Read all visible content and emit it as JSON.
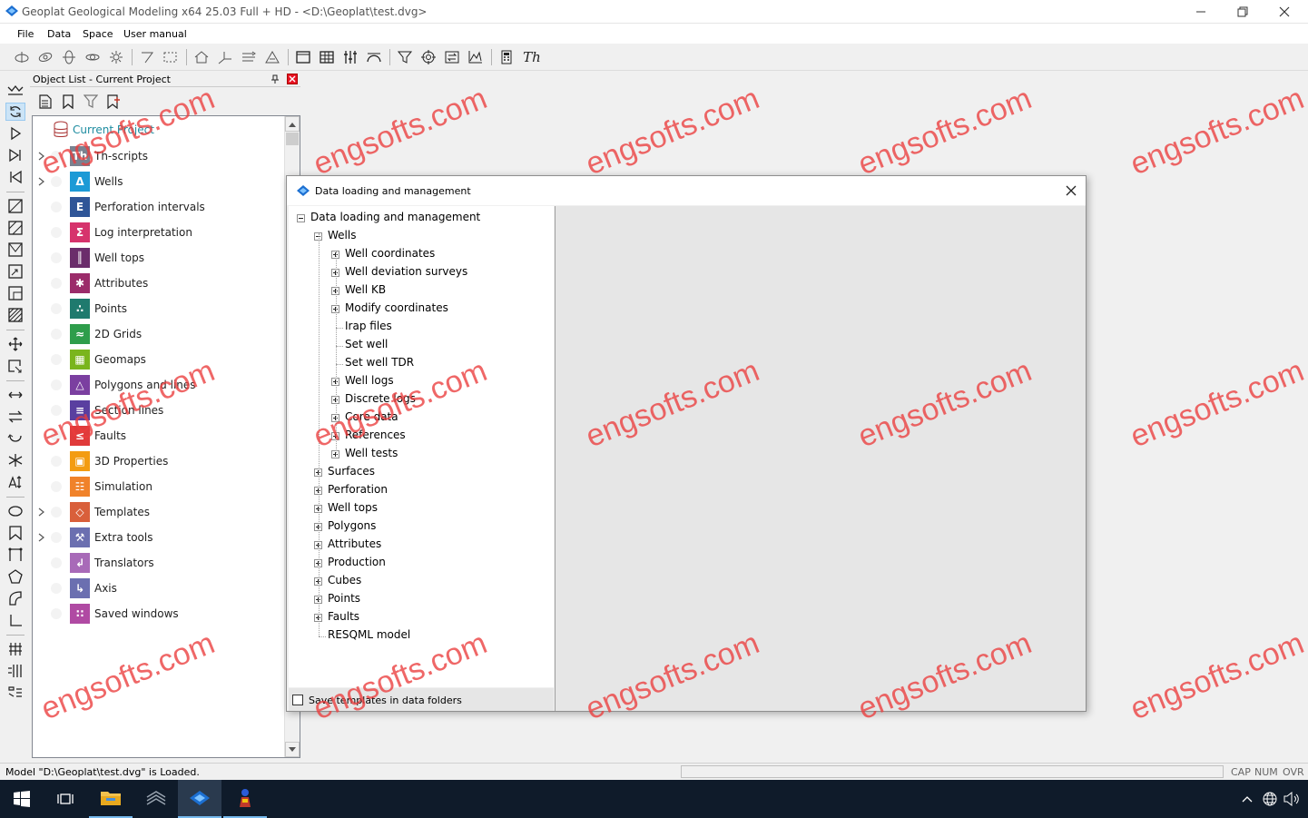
{
  "window": {
    "title": "Geoplat Geological Modeling x64  25.03 Full + HD - <D:\\Geoplat\\test.dvg>"
  },
  "menu": [
    "File",
    "Data",
    "Space",
    "User manual"
  ],
  "object_panel": {
    "title": "Object List - Current Project",
    "root": "Current Project",
    "items": [
      {
        "label": "Th-scripts",
        "icon": "th-scripts-icon",
        "color": "#7a8290",
        "expand": true
      },
      {
        "label": "Wells",
        "icon": "wells-icon",
        "color": "#1c9ad6",
        "expand": true
      },
      {
        "label": "Perforation intervals",
        "icon": "perforation-icon",
        "color": "#2f5597",
        "expand": false
      },
      {
        "label": "Log interpretation",
        "icon": "log-interpretation-icon",
        "color": "#d6336c",
        "expand": false
      },
      {
        "label": "Well tops",
        "icon": "well-tops-icon",
        "color": "#6b2d6b",
        "expand": false
      },
      {
        "label": "Attributes",
        "icon": "attributes-icon",
        "color": "#9b2c6a",
        "expand": false
      },
      {
        "label": "Points",
        "icon": "points-icon",
        "color": "#1f7a6e",
        "expand": false
      },
      {
        "label": "2D Grids",
        "icon": "grids-icon",
        "color": "#2e9d4b",
        "expand": false
      },
      {
        "label": "Geomaps",
        "icon": "geomaps-icon",
        "color": "#7ab51d",
        "expand": false
      },
      {
        "label": "Polygons and lines",
        "icon": "polygons-icon",
        "color": "#7b3fa0",
        "expand": false
      },
      {
        "label": "Section lines",
        "icon": "section-lines-icon",
        "color": "#5a3fa0",
        "expand": false
      },
      {
        "label": "Faults",
        "icon": "faults-icon",
        "color": "#e03a3a",
        "expand": false
      },
      {
        "label": "3D Properties",
        "icon": "3d-properties-icon",
        "color": "#f39c12",
        "expand": false
      },
      {
        "label": "Simulation",
        "icon": "simulation-icon",
        "color": "#f0822a",
        "expand": false
      },
      {
        "label": "Templates",
        "icon": "templates-icon",
        "color": "#d95f3a",
        "expand": true
      },
      {
        "label": "Extra tools",
        "icon": "extra-tools-icon",
        "color": "#6b6fb0",
        "expand": true
      },
      {
        "label": "Translators",
        "icon": "translators-icon",
        "color": "#a86ab8",
        "expand": false
      },
      {
        "label": "Axis",
        "icon": "axis-icon",
        "color": "#6b6fb0",
        "expand": false
      },
      {
        "label": "Saved windows",
        "icon": "saved-windows-icon",
        "color": "#b04aa3",
        "expand": false
      }
    ]
  },
  "dialog": {
    "title": "Data loading and management",
    "checkbox_label": "Save templates in data folders",
    "tree": [
      {
        "label": "Data loading and management",
        "level": 0,
        "node": "minus"
      },
      {
        "label": "Wells",
        "level": 1,
        "node": "minus"
      },
      {
        "label": "Well coordinates",
        "level": 2,
        "node": "plus"
      },
      {
        "label": "Well deviation surveys",
        "level": 2,
        "node": "plus"
      },
      {
        "label": "Well KB",
        "level": 2,
        "node": "plus"
      },
      {
        "label": "Modify coordinates",
        "level": 2,
        "node": "plus"
      },
      {
        "label": "Irap files",
        "level": 2,
        "node": "leaf"
      },
      {
        "label": "Set well",
        "level": 2,
        "node": "leaf"
      },
      {
        "label": "Set well TDR",
        "level": 2,
        "node": "leaf"
      },
      {
        "label": "Well logs",
        "level": 2,
        "node": "plus"
      },
      {
        "label": "Discrete logs",
        "level": 2,
        "node": "plus"
      },
      {
        "label": "Core data",
        "level": 2,
        "node": "plus"
      },
      {
        "label": "References",
        "level": 2,
        "node": "plus"
      },
      {
        "label": "Well tests",
        "level": 2,
        "node": "plus"
      },
      {
        "label": "Surfaces",
        "level": 1,
        "node": "plus"
      },
      {
        "label": "Perforation",
        "level": 1,
        "node": "plus"
      },
      {
        "label": "Well tops",
        "level": 1,
        "node": "plus"
      },
      {
        "label": "Polygons",
        "level": 1,
        "node": "plus"
      },
      {
        "label": "Attributes",
        "level": 1,
        "node": "plus"
      },
      {
        "label": "Production",
        "level": 1,
        "node": "plus"
      },
      {
        "label": "Cubes",
        "level": 1,
        "node": "plus"
      },
      {
        "label": "Points",
        "level": 1,
        "node": "plus"
      },
      {
        "label": "Faults",
        "level": 1,
        "node": "plus"
      },
      {
        "label": "RESQML model",
        "level": 1,
        "node": "leaf"
      }
    ]
  },
  "toolbar": {
    "th_label": "Th"
  },
  "status": {
    "message": "Model \"D:\\Geoplat\\test.dvg\" is Loaded.",
    "indicators": [
      "CAP",
      "NUM",
      "OVR"
    ]
  },
  "watermark": "engsofts.com",
  "colors": {
    "accent": "#1e8ca0",
    "taskbar": "#0f1b2a",
    "close_red": "#e81123",
    "watermark": "#eb3c3c"
  }
}
